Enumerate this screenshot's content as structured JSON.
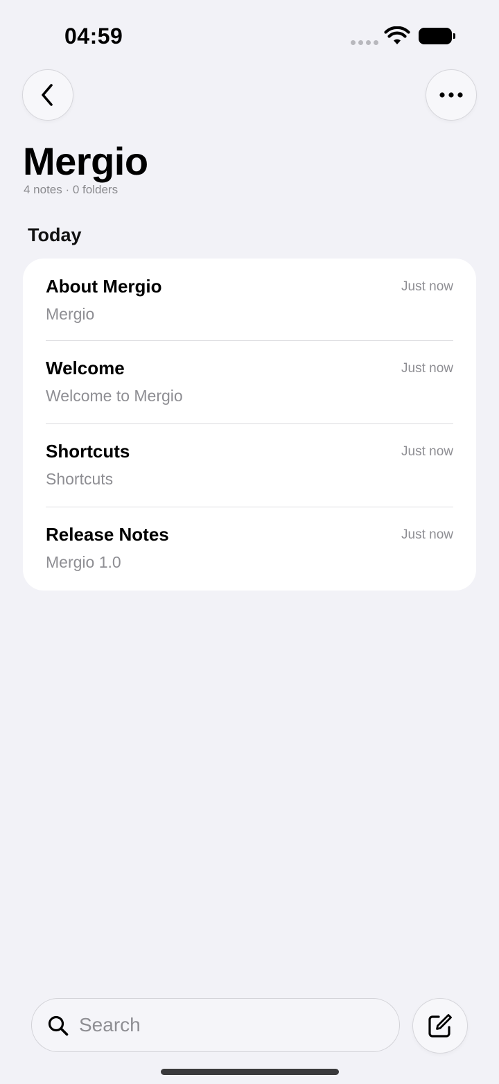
{
  "status_bar": {
    "time": "04:59"
  },
  "header": {
    "title": "Mergio",
    "subtitle": "4 notes · 0 folders"
  },
  "section": {
    "label": "Today"
  },
  "notes": [
    {
      "title": "About Mergio",
      "preview": "Mergio",
      "time": "Just now"
    },
    {
      "title": "Welcome",
      "preview": "Welcome to Mergio",
      "time": "Just now"
    },
    {
      "title": "Shortcuts",
      "preview": "Shortcuts",
      "time": "Just now"
    },
    {
      "title": "Release Notes",
      "preview": "Mergio 1.0",
      "time": "Just now"
    }
  ],
  "search": {
    "placeholder": "Search",
    "value": ""
  },
  "icons": {
    "back": "chevron-left-icon",
    "more": "ellipsis-icon",
    "search": "magnifier-icon",
    "compose": "compose-icon",
    "wifi": "wifi-icon",
    "battery": "battery-icon",
    "signal": "signal-icon"
  },
  "colors": {
    "background": "#f2f2f7",
    "card": "#ffffff",
    "secondary_text": "#8e8e93"
  }
}
